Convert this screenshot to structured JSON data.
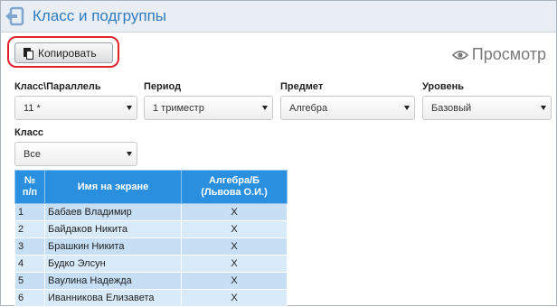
{
  "window": {
    "title": "Класс и подгруппы"
  },
  "toolbar": {
    "copy_label": "Копировать",
    "preview_label": "Просмотр"
  },
  "filters": {
    "class_parallel": {
      "label": "Класс\\Параллель",
      "value": "11 *"
    },
    "period": {
      "label": "Период",
      "value": "1 триместр"
    },
    "subject": {
      "label": "Предмет",
      "value": "Алгебра"
    },
    "level": {
      "label": "Уровень",
      "value": "Базовый"
    },
    "class": {
      "label": "Класс",
      "value": "Все"
    }
  },
  "table": {
    "headers": {
      "num_line1": "№",
      "num_line2": "п/п",
      "name": "Имя на экране",
      "subject_line1": "Алгебра/Б",
      "subject_line2": "(Львова О.И.)"
    },
    "rows": [
      {
        "num": "1",
        "name": "Бабаев Владимир",
        "mark": "X"
      },
      {
        "num": "2",
        "name": "Байдаков Никита",
        "mark": "X"
      },
      {
        "num": "3",
        "name": "Брашкин Никита",
        "mark": "X"
      },
      {
        "num": "4",
        "name": "Будко Элсун",
        "mark": "X"
      },
      {
        "num": "5",
        "name": "Ваулина Надежда",
        "mark": "X"
      },
      {
        "num": "6",
        "name": "Иванникова Елизавета",
        "mark": "X"
      }
    ]
  },
  "colors": {
    "title": "#2f7bbf",
    "header_bg": "#2b8fe0",
    "row_odd": "#c6dff4",
    "row_even": "#d9eaf8",
    "highlight": "#e0242b"
  }
}
